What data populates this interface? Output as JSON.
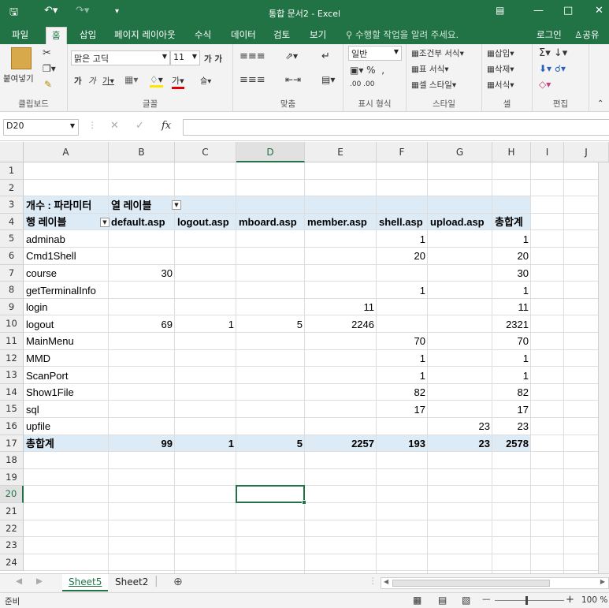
{
  "window": {
    "title": "통합 문서2 - Excel"
  },
  "tabs": [
    "파일",
    "홈",
    "삽입",
    "페이지 레이아웃",
    "수식",
    "데이터",
    "검토",
    "보기"
  ],
  "tell_me": "수행할 작업을 알려 주세요.",
  "account": {
    "login": "로그인",
    "share": "공유"
  },
  "ribbon": {
    "clipboard": {
      "label": "클립보드",
      "paste": "붙여넣기"
    },
    "font": {
      "label": "글꼴",
      "name": "맑은 고딕",
      "size": "11"
    },
    "alignment": {
      "label": "맞춤"
    },
    "number": {
      "label": "표시 형식",
      "format": "일반"
    },
    "styles": {
      "label": "스타일",
      "conditional": "조건부 서식",
      "table": "표 서식",
      "cell_styles": "셀 스타일"
    },
    "cells": {
      "label": "셀",
      "insert": "삽입",
      "delete": "삭제",
      "format": "서식"
    },
    "editing": {
      "label": "편집"
    }
  },
  "formula_bar": {
    "name_box": "D20",
    "fx": "fx",
    "value": ""
  },
  "columns": [
    "A",
    "B",
    "C",
    "D",
    "E",
    "F",
    "G",
    "H",
    "I",
    "J"
  ],
  "selected_column": "D",
  "rows": [
    "1",
    "2",
    "3",
    "4",
    "5",
    "6",
    "7",
    "8",
    "9",
    "10",
    "11",
    "12",
    "13",
    "14",
    "15",
    "16",
    "17",
    "18",
    "19",
    "20",
    "21",
    "22",
    "23",
    "24"
  ],
  "selected_row": "20",
  "pivot": {
    "count_label": "개수 : 파라미터",
    "col_labels": "열 레이블",
    "row_labels": "행 레이블",
    "headers": [
      "default.asp",
      "logout.asp",
      "mboard.asp",
      "member.asp",
      "shell.asp",
      "upload.asp",
      "총합계"
    ],
    "rows": [
      {
        "label": "adminab",
        "values": [
          "",
          "",
          "",
          "",
          "1",
          "",
          "1"
        ]
      },
      {
        "label": "Cmd1Shell",
        "values": [
          "",
          "",
          "",
          "",
          "20",
          "",
          "20"
        ]
      },
      {
        "label": "course",
        "values": [
          "30",
          "",
          "",
          "",
          "",
          "",
          "30"
        ]
      },
      {
        "label": "getTerminalInfo",
        "values": [
          "",
          "",
          "",
          "",
          "1",
          "",
          "1"
        ]
      },
      {
        "label": "login",
        "values": [
          "",
          "",
          "",
          "11",
          "",
          "",
          "11"
        ]
      },
      {
        "label": "logout",
        "values": [
          "69",
          "1",
          "5",
          "2246",
          "",
          "",
          "2321"
        ]
      },
      {
        "label": "MainMenu",
        "values": [
          "",
          "",
          "",
          "",
          "70",
          "",
          "70"
        ]
      },
      {
        "label": "MMD",
        "values": [
          "",
          "",
          "",
          "",
          "1",
          "",
          "1"
        ]
      },
      {
        "label": "ScanPort",
        "values": [
          "",
          "",
          "",
          "",
          "1",
          "",
          "1"
        ]
      },
      {
        "label": "Show1File",
        "values": [
          "",
          "",
          "",
          "",
          "82",
          "",
          "82"
        ]
      },
      {
        "label": "sql",
        "values": [
          "",
          "",
          "",
          "",
          "17",
          "",
          "17"
        ]
      },
      {
        "label": "upfile",
        "values": [
          "",
          "",
          "",
          "",
          "",
          "23",
          "23"
        ]
      }
    ],
    "total": {
      "label": "총합계",
      "values": [
        "99",
        "1",
        "5",
        "2257",
        "193",
        "23",
        "2578"
      ]
    }
  },
  "sheets": [
    "Sheet5",
    "Sheet2"
  ],
  "active_sheet": "Sheet5",
  "status": {
    "mode": "준비",
    "zoom": "100 %"
  },
  "colors": {
    "accent": "#217346",
    "pivot_band": "#ddebf7"
  }
}
